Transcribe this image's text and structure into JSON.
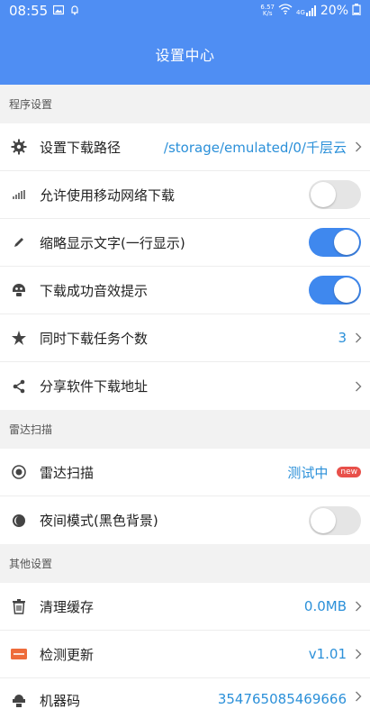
{
  "status_bar": {
    "time": "08:55",
    "speed_top": "6.57",
    "speed_bottom": "K/s",
    "network": "4G",
    "battery": "20%"
  },
  "header": {
    "title": "设置中心"
  },
  "sections": {
    "program": "程序设置",
    "radar": "雷达扫描",
    "other": "其他设置"
  },
  "rows": {
    "download_path": {
      "label": "设置下载路径",
      "value": "/storage/emulated/0/千层云"
    },
    "mobile_network": {
      "label": "允许使用移动网络下载",
      "toggle": false
    },
    "thumbnail_text": {
      "label": "缩略显示文字(一行显示)",
      "toggle": true
    },
    "download_sound": {
      "label": "下载成功音效提示",
      "toggle": true
    },
    "concurrent_tasks": {
      "label": "同时下载任务个数",
      "value": "3"
    },
    "share_link": {
      "label": "分享软件下载地址"
    },
    "radar_scan": {
      "label": "雷达扫描",
      "value": "测试中",
      "badge": "new"
    },
    "night_mode": {
      "label": "夜间模式(黑色背景)",
      "toggle": false
    },
    "clear_cache": {
      "label": "清理缓存",
      "value": "0.0MB"
    },
    "check_update": {
      "label": "检测更新",
      "value": "v1.01"
    },
    "machine_code": {
      "label": "机器码",
      "value": "354765085469666"
    }
  },
  "colors": {
    "header": "#4f8ef3",
    "accent_text": "#2b90d9",
    "toggle_on": "#3f88ee",
    "badge": "#e8504a"
  }
}
